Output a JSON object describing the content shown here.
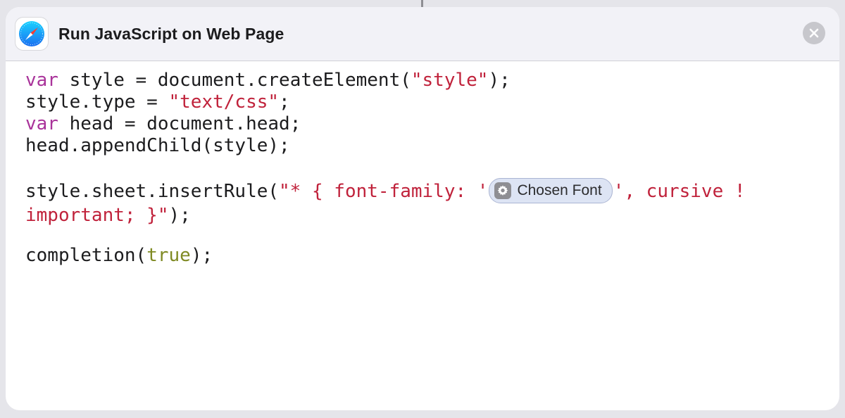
{
  "action": {
    "title": "Run JavaScript on Web Page",
    "app_icon": "safari-compass-icon",
    "close_icon": "close-icon"
  },
  "code": {
    "line1": {
      "kw": "var",
      "rest": " style = document.createElement(",
      "str": "\"style\"",
      "end": ");"
    },
    "line2": {
      "pre": "style.type = ",
      "str": "\"text/css\"",
      "end": ";"
    },
    "line3": {
      "kw": "var",
      "rest": " head = document.head;"
    },
    "line4": {
      "text": "head.appendChild(style);"
    },
    "line5": {
      "pre": "style.sheet.insertRule(",
      "str1": "\"* { font-family: '",
      "token_label": "Chosen Font",
      "token_icon": "gear-icon",
      "str2": "', cursive !"
    },
    "line6": {
      "str": "important; }\"",
      "end": ");"
    },
    "line7": {
      "pre": "completion(",
      "lit": "true",
      "end": ");"
    }
  },
  "colors": {
    "keyword": "#a9339a",
    "string": "#c0223b",
    "literal": "#7f8a23",
    "token_bg": "#dde4f4"
  }
}
